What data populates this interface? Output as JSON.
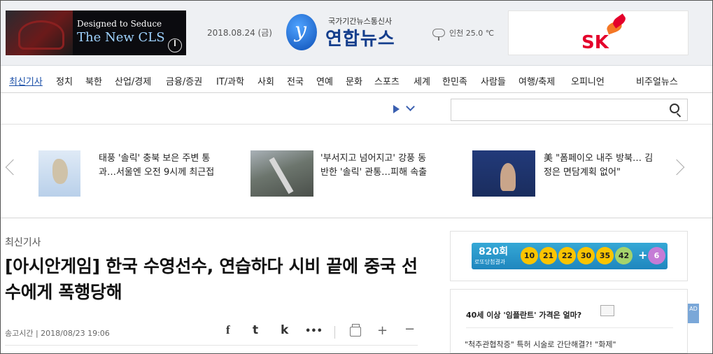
{
  "header": {
    "ad_left": {
      "line1": "Designed to Seduce",
      "line2": "The New CLS"
    },
    "date": "2018.08.24 (금)",
    "logo": {
      "subtitle": "국가기간뉴스통신사",
      "name": "연합뉴스",
      "mark": "y"
    },
    "weather": "인천 25.0 ℃",
    "ad_right": {
      "brand": "SK"
    }
  },
  "nav": {
    "items": [
      "최신기사",
      "정치",
      "북한",
      "산업/경제",
      "금융/증권",
      "IT/과학",
      "사회",
      "전국",
      "연예",
      "문화",
      "스포츠",
      "세계",
      "한민족",
      "사람들",
      "여행/축제",
      "오피니언",
      "비주얼뉴스"
    ]
  },
  "search": {
    "placeholder": ""
  },
  "carousel": {
    "cards": [
      {
        "text": "태풍 '솔릭' 충북 보은 주변 통과…서울엔 오전 9시께 최근접"
      },
      {
        "text": "'부서지고 넘어지고' 강풍 동반한 '솔릭' 관통…피해 속출"
      },
      {
        "text": "美 \"폼페이오 내주 방북… 김정은 면담계획 없어\""
      }
    ]
  },
  "article": {
    "section": "최신기사",
    "headline": "[아시안게임] 한국 수영선수, 연습하다 시비 끝에 중국 선수에게 폭행당해",
    "meta": "송고시간 | 2018/08/23 19:06",
    "share_icons": [
      "f",
      "t",
      "k",
      "•••"
    ]
  },
  "lotto": {
    "round": "820회",
    "label": "로또당첨결과",
    "numbers": [
      "10",
      "21",
      "22",
      "30",
      "35",
      "42"
    ],
    "plus": "+",
    "bonus": "6"
  },
  "side_ad": {
    "title": "40세 이상 '임플란트' 가격은 얼마?",
    "text": "\"척추관협착증\" 특허 시술로 간단해결?! \"화제\"",
    "badge": "AD"
  },
  "colors": {
    "brand": "#143e8c",
    "nav_active": "#1a4fa8",
    "lotto": "#1f86be",
    "sk_red": "#e4002b"
  }
}
